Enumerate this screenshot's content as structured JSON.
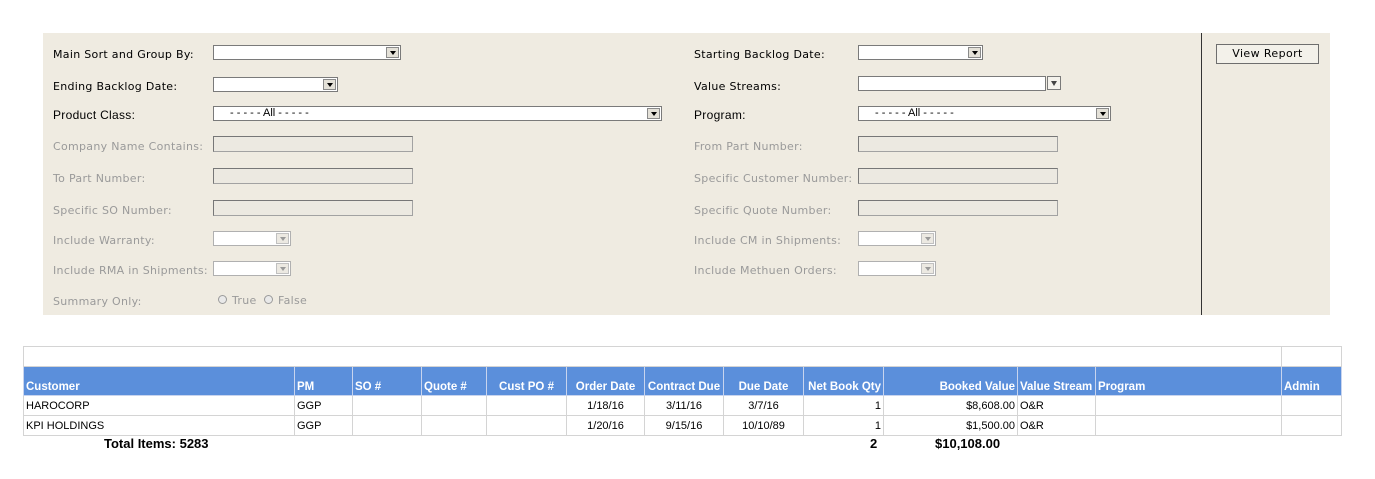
{
  "params": {
    "main_sort_label": "Main Sort and Group By:",
    "starting_backlog_label": "Starting Backlog Date:",
    "ending_backlog_label": "Ending Backlog Date:",
    "value_streams_label": "Value Streams:",
    "product_class_label": "Product Class:",
    "product_class_value": "- - - - - All - - - - -",
    "program_label": "Program:",
    "program_value": "- - - - - All - - - - -",
    "company_name_label": "Company Name Contains:",
    "from_part_label": "From Part Number:",
    "to_part_label": "To Part Number:",
    "specific_customer_label": "Specific Customer Number:",
    "specific_so_label": "Specific SO Number:",
    "specific_quote_label": "Specific Quote Number:",
    "include_warranty_label": "Include Warranty:",
    "include_cm_label": "Include CM in Shipments:",
    "include_rma_label": "Include RMA in Shipments:",
    "include_methuen_label": "Include Methuen Orders:",
    "summary_only_label": "Summary Only:",
    "summary_true": "True",
    "summary_false": "False",
    "view_report": "View Report"
  },
  "table": {
    "columns": [
      "Customer",
      "PM",
      "SO #",
      "Quote #",
      "Cust PO #",
      "Order Date",
      "Contract Due",
      "Due Date",
      "Net Book Qty",
      "Booked Value",
      "Value Stream",
      "Program",
      "Admin"
    ],
    "rows": [
      [
        "HAROCORP",
        "GGP",
        "",
        "",
        "",
        "1/18/16",
        "3/11/16",
        "3/7/16",
        "1",
        "$8,608.00",
        "O&R",
        "",
        ""
      ],
      [
        "KPI HOLDINGS",
        "GGP",
        "",
        "",
        "",
        "1/20/16",
        "9/15/16",
        "10/10/89",
        "1",
        "$1,500.00",
        "O&R",
        "",
        ""
      ]
    ],
    "total_items": "Total Items: 5283",
    "total_qty": "2",
    "total_value": "$10,108.00"
  }
}
